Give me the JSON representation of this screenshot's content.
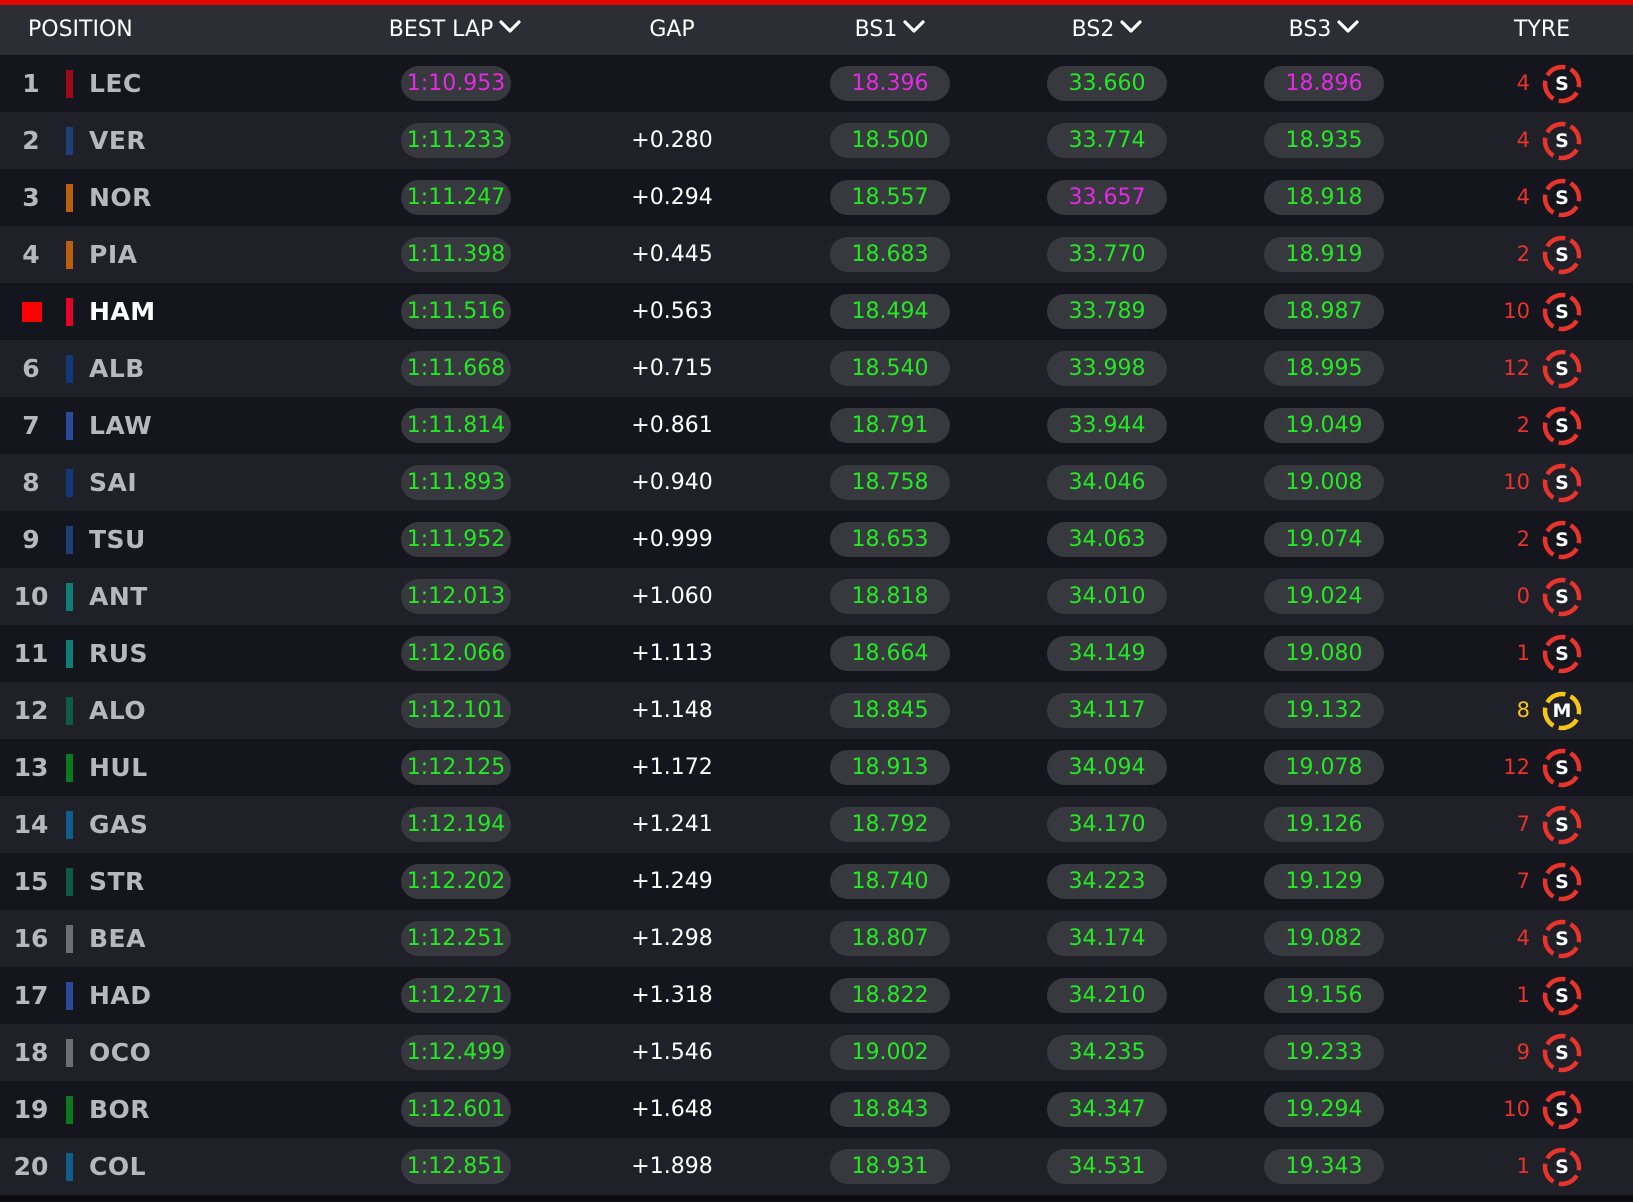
{
  "header": {
    "position_label": "POSITION",
    "best_lap_label": "BEST LAP",
    "gap_label": "GAP",
    "bs1_label": "BS1",
    "bs2_label": "BS2",
    "bs3_label": "BS3",
    "tyre_label": "TYRE"
  },
  "colors": {
    "accent_red": "#e10600",
    "green_time": "#23e823",
    "purple_time": "#e22be2",
    "soft_tyre": "#e8342a",
    "medium_tyre": "#f5c518"
  },
  "rows": [
    {
      "pos": "1",
      "driver": "LEC",
      "team_color": "#9b0b1a",
      "best_lap": "1:10.953",
      "best_lap_purple": true,
      "gap": "",
      "bs1": "18.396",
      "bs1_purple": true,
      "bs2": "33.660",
      "bs2_purple": false,
      "bs3": "18.896",
      "bs3_purple": true,
      "laps": "4",
      "tyre": "S",
      "tyre_compound": "soft"
    },
    {
      "pos": "2",
      "driver": "VER",
      "team_color": "#1e3f77",
      "best_lap": "1:11.233",
      "best_lap_purple": false,
      "gap": "+0.280",
      "bs1": "18.500",
      "bs1_purple": false,
      "bs2": "33.774",
      "bs2_purple": false,
      "bs3": "18.935",
      "bs3_purple": false,
      "laps": "4",
      "tyre": "S",
      "tyre_compound": "soft"
    },
    {
      "pos": "3",
      "driver": "NOR",
      "team_color": "#b8600f",
      "best_lap": "1:11.247",
      "best_lap_purple": false,
      "gap": "+0.294",
      "bs1": "18.557",
      "bs1_purple": false,
      "bs2": "33.657",
      "bs2_purple": true,
      "bs3": "18.918",
      "bs3_purple": false,
      "laps": "4",
      "tyre": "S",
      "tyre_compound": "soft"
    },
    {
      "pos": "4",
      "driver": "PIA",
      "team_color": "#b8600f",
      "best_lap": "1:11.398",
      "best_lap_purple": false,
      "gap": "+0.445",
      "bs1": "18.683",
      "bs1_purple": false,
      "bs2": "33.770",
      "bs2_purple": false,
      "bs3": "18.919",
      "bs3_purple": false,
      "laps": "2",
      "tyre": "S",
      "tyre_compound": "soft"
    },
    {
      "pos": "",
      "driver": "HAM",
      "highlight": true,
      "team_color": "#e8002d",
      "best_lap": "1:11.516",
      "best_lap_purple": false,
      "gap": "+0.563",
      "bs1": "18.494",
      "bs1_purple": false,
      "bs2": "33.789",
      "bs2_purple": false,
      "bs3": "18.987",
      "bs3_purple": false,
      "laps": "10",
      "tyre": "S",
      "tyre_compound": "soft"
    },
    {
      "pos": "6",
      "driver": "ALB",
      "team_color": "#123a7a",
      "best_lap": "1:11.668",
      "best_lap_purple": false,
      "gap": "+0.715",
      "bs1": "18.540",
      "bs1_purple": false,
      "bs2": "33.998",
      "bs2_purple": false,
      "bs3": "18.995",
      "bs3_purple": false,
      "laps": "12",
      "tyre": "S",
      "tyre_compound": "soft"
    },
    {
      "pos": "7",
      "driver": "LAW",
      "team_color": "#2b4a9e",
      "best_lap": "1:11.814",
      "best_lap_purple": false,
      "gap": "+0.861",
      "bs1": "18.791",
      "bs1_purple": false,
      "bs2": "33.944",
      "bs2_purple": false,
      "bs3": "19.049",
      "bs3_purple": false,
      "laps": "2",
      "tyre": "S",
      "tyre_compound": "soft"
    },
    {
      "pos": "8",
      "driver": "SAI",
      "team_color": "#123a7a",
      "best_lap": "1:11.893",
      "best_lap_purple": false,
      "gap": "+0.940",
      "bs1": "18.758",
      "bs1_purple": false,
      "bs2": "34.046",
      "bs2_purple": false,
      "bs3": "19.008",
      "bs3_purple": false,
      "laps": "10",
      "tyre": "S",
      "tyre_compound": "soft"
    },
    {
      "pos": "9",
      "driver": "TSU",
      "team_color": "#1e3f77",
      "best_lap": "1:11.952",
      "best_lap_purple": false,
      "gap": "+0.999",
      "bs1": "18.653",
      "bs1_purple": false,
      "bs2": "34.063",
      "bs2_purple": false,
      "bs3": "19.074",
      "bs3_purple": false,
      "laps": "2",
      "tyre": "S",
      "tyre_compound": "soft"
    },
    {
      "pos": "10",
      "driver": "ANT",
      "team_color": "#0f7f75",
      "best_lap": "1:12.013",
      "best_lap_purple": false,
      "gap": "+1.060",
      "bs1": "18.818",
      "bs1_purple": false,
      "bs2": "34.010",
      "bs2_purple": false,
      "bs3": "19.024",
      "bs3_purple": false,
      "laps": "0",
      "tyre": "S",
      "tyre_compound": "soft"
    },
    {
      "pos": "11",
      "driver": "RUS",
      "team_color": "#0f7f75",
      "best_lap": "1:12.066",
      "best_lap_purple": false,
      "gap": "+1.113",
      "bs1": "18.664",
      "bs1_purple": false,
      "bs2": "34.149",
      "bs2_purple": false,
      "bs3": "19.080",
      "bs3_purple": false,
      "laps": "1",
      "tyre": "S",
      "tyre_compound": "soft"
    },
    {
      "pos": "12",
      "driver": "ALO",
      "team_color": "#0d5b46",
      "best_lap": "1:12.101",
      "best_lap_purple": false,
      "gap": "+1.148",
      "bs1": "18.845",
      "bs1_purple": false,
      "bs2": "34.117",
      "bs2_purple": false,
      "bs3": "19.132",
      "bs3_purple": false,
      "laps": "8",
      "tyre": "M",
      "tyre_compound": "medium"
    },
    {
      "pos": "13",
      "driver": "HUL",
      "team_color": "#0b7a1e",
      "best_lap": "1:12.125",
      "best_lap_purple": false,
      "gap": "+1.172",
      "bs1": "18.913",
      "bs1_purple": false,
      "bs2": "34.094",
      "bs2_purple": false,
      "bs3": "19.078",
      "bs3_purple": false,
      "laps": "12",
      "tyre": "S",
      "tyre_compound": "soft"
    },
    {
      "pos": "14",
      "driver": "GAS",
      "team_color": "#0e5e8e",
      "best_lap": "1:12.194",
      "best_lap_purple": false,
      "gap": "+1.241",
      "bs1": "18.792",
      "bs1_purple": false,
      "bs2": "34.170",
      "bs2_purple": false,
      "bs3": "19.126",
      "bs3_purple": false,
      "laps": "7",
      "tyre": "S",
      "tyre_compound": "soft"
    },
    {
      "pos": "15",
      "driver": "STR",
      "team_color": "#0d5b46",
      "best_lap": "1:12.202",
      "best_lap_purple": false,
      "gap": "+1.249",
      "bs1": "18.740",
      "bs1_purple": false,
      "bs2": "34.223",
      "bs2_purple": false,
      "bs3": "19.129",
      "bs3_purple": false,
      "laps": "7",
      "tyre": "S",
      "tyre_compound": "soft"
    },
    {
      "pos": "16",
      "driver": "BEA",
      "team_color": "#6e6e74",
      "best_lap": "1:12.251",
      "best_lap_purple": false,
      "gap": "+1.298",
      "bs1": "18.807",
      "bs1_purple": false,
      "bs2": "34.174",
      "bs2_purple": false,
      "bs3": "19.082",
      "bs3_purple": false,
      "laps": "4",
      "tyre": "S",
      "tyre_compound": "soft"
    },
    {
      "pos": "17",
      "driver": "HAD",
      "team_color": "#2b4a9e",
      "best_lap": "1:12.271",
      "best_lap_purple": false,
      "gap": "+1.318",
      "bs1": "18.822",
      "bs1_purple": false,
      "bs2": "34.210",
      "bs2_purple": false,
      "bs3": "19.156",
      "bs3_purple": false,
      "laps": "1",
      "tyre": "S",
      "tyre_compound": "soft"
    },
    {
      "pos": "18",
      "driver": "OCO",
      "team_color": "#6e6e74",
      "best_lap": "1:12.499",
      "best_lap_purple": false,
      "gap": "+1.546",
      "bs1": "19.002",
      "bs1_purple": false,
      "bs2": "34.235",
      "bs2_purple": false,
      "bs3": "19.233",
      "bs3_purple": false,
      "laps": "9",
      "tyre": "S",
      "tyre_compound": "soft"
    },
    {
      "pos": "19",
      "driver": "BOR",
      "team_color": "#0b7a1e",
      "best_lap": "1:12.601",
      "best_lap_purple": false,
      "gap": "+1.648",
      "bs1": "18.843",
      "bs1_purple": false,
      "bs2": "34.347",
      "bs2_purple": false,
      "bs3": "19.294",
      "bs3_purple": false,
      "laps": "10",
      "tyre": "S",
      "tyre_compound": "soft"
    },
    {
      "pos": "20",
      "driver": "COL",
      "team_color": "#0e5e8e",
      "best_lap": "1:12.851",
      "best_lap_purple": false,
      "gap": "+1.898",
      "bs1": "18.931",
      "bs1_purple": false,
      "bs2": "34.531",
      "bs2_purple": false,
      "bs3": "19.343",
      "bs3_purple": false,
      "laps": "1",
      "tyre": "S",
      "tyre_compound": "soft"
    }
  ]
}
